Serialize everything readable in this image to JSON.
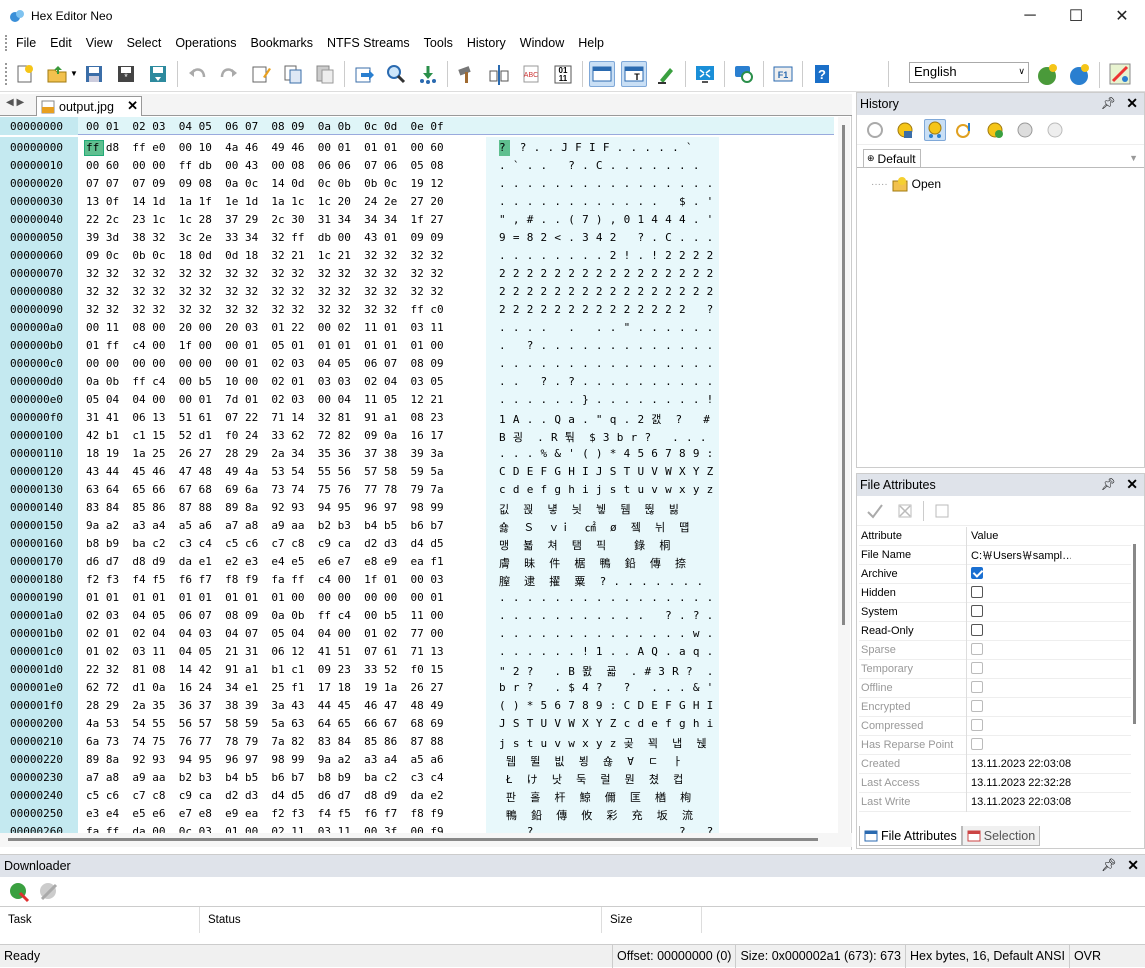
{
  "app": {
    "title": "Hex Editor Neo"
  },
  "window_controls": {
    "minimize": "─",
    "maximize": "☐",
    "close": "✕"
  },
  "menu": [
    "File",
    "Edit",
    "View",
    "Select",
    "Operations",
    "Bookmarks",
    "NTFS Streams",
    "Tools",
    "History",
    "Window",
    "Help"
  ],
  "language": {
    "selected": "English"
  },
  "editor": {
    "tab_label": "output.jpg",
    "header_offset": "00000000",
    "header_cols": "00 01  02 03  04 05  06 07  08 09  0a 0b  0c 0d  0e 0f",
    "rows": [
      {
        "off": "00000000",
        "hex": "ff d8  ff e0  00 10  4a 46  49 46  00 01  01 01  00 60",
        "asc": "?  ? . . J F I F . . . . . `"
      },
      {
        "off": "00000010",
        "hex": "00 60  00 00  ff db  00 43  00 08  06 06  07 06  05 08",
        "asc": ". ` . .   ? . C . . . . . . ."
      },
      {
        "off": "00000020",
        "hex": "07 07  07 09  09 08  0a 0c  14 0d  0c 0b  0b 0c  19 12",
        "asc": ". . . . . . . . . . . . . . . ."
      },
      {
        "off": "00000030",
        "hex": "13 0f  14 1d  1a 1f  1e 1d  1a 1c  1c 20  24 2e  27 20",
        "asc": ". . . . . . . . . . . .   $ . '"
      },
      {
        "off": "00000040",
        "hex": "22 2c  23 1c  1c 28  37 29  2c 30  31 34  34 34  1f 27",
        "asc": "\" , # . . ( 7 ) , 0 1 4 4 4 . '"
      },
      {
        "off": "00000050",
        "hex": "39 3d  38 32  3c 2e  33 34  32 ff  db 00  43 01  09 09",
        "asc": "9 = 8 2 < . 3 4 2   ? . C . . ."
      },
      {
        "off": "00000060",
        "hex": "09 0c  0b 0c  18 0d  0d 18  32 21  1c 21  32 32  32 32",
        "asc": ". . . . . . . . 2 ! . ! 2 2 2 2"
      },
      {
        "off": "00000070",
        "hex": "32 32  32 32  32 32  32 32  32 32  32 32  32 32  32 32",
        "asc": "2 2 2 2 2 2 2 2 2 2 2 2 2 2 2 2"
      },
      {
        "off": "00000080",
        "hex": "32 32  32 32  32 32  32 32  32 32  32 32  32 32  32 32",
        "asc": "2 2 2 2 2 2 2 2 2 2 2 2 2 2 2 2"
      },
      {
        "off": "00000090",
        "hex": "32 32  32 32  32 32  32 32  32 32  32 32  32 32  ff c0",
        "asc": "2 2 2 2 2 2 2 2 2 2 2 2 2 2   ?"
      },
      {
        "off": "000000a0",
        "hex": "00 11  08 00  20 00  20 03  01 22  00 02  11 01  03 11",
        "asc": ". . . .   .   . . \" . . . . . ."
      },
      {
        "off": "000000b0",
        "hex": "01 ff  c4 00  1f 00  00 01  05 01  01 01  01 01  01 00",
        "asc": ".   ? . . . . . . . . . . . . ."
      },
      {
        "off": "000000c0",
        "hex": "00 00  00 00  00 00  00 01  02 03  04 05  06 07  08 09",
        "asc": ". . . . . . . . . . . . . . . ."
      },
      {
        "off": "000000d0",
        "hex": "0a 0b  ff c4  00 b5  10 00  02 01  03 03  02 04  03 05",
        "asc": ". .   ? . ? . . . . . . . . . ."
      },
      {
        "off": "000000e0",
        "hex": "05 04  04 00  00 01  7d 01  02 03  00 04  11 05  12 21",
        "asc": ". . . . . . } . . . . . . . . !"
      },
      {
        "off": "000000f0",
        "hex": "31 41  06 13  51 61  07 22  71 14  32 81  91 a1  08 23",
        "asc": "1 A . . Q a . \" q . 2 갨  ?   #"
      },
      {
        "off": "00000100",
        "hex": "42 b1  c1 15  52 d1  f0 24  33 62  72 82  09 0a  16 17",
        "asc": "B 굉  . R 퉊  $ 3 b r ?   . . ."
      },
      {
        "off": "00000110",
        "hex": "18 19  1a 25  26 27  28 29  2a 34  35 36  37 38  39 3a",
        "asc": ". . . % & ' ( ) * 4 5 6 7 8 9 :"
      },
      {
        "off": "00000120",
        "hex": "43 44  45 46  47 48  49 4a  53 54  55 56  57 58  59 5a",
        "asc": "C D E F G H I J S T U V W X Y Z"
      },
      {
        "off": "00000130",
        "hex": "63 64  65 66  67 68  69 6a  73 74  75 76  77 78  79 7a",
        "asc": "c d e f g h i j s t u v w x y z"
      },
      {
        "off": "00000140",
        "hex": "83 84  85 86  87 88  89 8a  92 93  94 95  96 97  98 99",
        "asc": "깂  꾅  넇  늿  뉗  뒘  뛶  빓"
      },
      {
        "off": "00000150",
        "hex": "9a a2  a3 a4  a5 a6  a7 a8  a9 aa  b2 b3  b4 b5  b6 b7",
        "asc": "숋  Ｓ  ｖｉ  ㎠  ø  젴  뉘  떕"
      },
      {
        "off": "00000160",
        "hex": "b8 b9  ba c2  c3 c4  c5 c6  c7 c8  c9 ca  d2 d3  d4 d5",
        "asc": "맹  뵯  쳐  탬  픽    錄  桐"
      },
      {
        "off": "00000170",
        "hex": "d6 d7  d8 d9  da e1  e2 e3  e4 e5  e6 e7  e8 e9  ea f1",
        "asc": "膚  昧  件  椐  鴨  鉛  傳  捺"
      },
      {
        "off": "00000180",
        "hex": "f2 f3  f4 f5  f6 f7  f8 f9  fa ff  c4 00  1f 01  00 03",
        "asc": "膣  逮  擢  粟  ? . . . . . . ."
      },
      {
        "off": "00000190",
        "hex": "01 01  01 01  01 01  01 01  01 00  00 00  00 00  00 01",
        "asc": ". . . . . . . . . . . . . . . ."
      },
      {
        "off": "000001a0",
        "hex": "02 03  04 05  06 07  08 09  0a 0b  ff c4  00 b5  11 00",
        "asc": ". . . . . . . . . . .   ? . ? ."
      },
      {
        "off": "000001b0",
        "hex": "02 01  02 04  04 03  04 07  05 04  04 00  01 02  77 00",
        "asc": ". . . . . . . . . . . . . . w ."
      },
      {
        "off": "000001c0",
        "hex": "01 02  03 11  04 05  21 31  06 12  41 51  07 61  71 13",
        "asc": ". . . . . . ! 1 . . A Q . a q ."
      },
      {
        "off": "000001d0",
        "hex": "22 32  81 08  14 42  91 a1  b1 c1  09 23  33 52  f0 15",
        "asc": "\" 2 ?   . B 뫐  굛  . # 3 R ?  ."
      },
      {
        "off": "000001e0",
        "hex": "62 72  d1 0a  16 24  34 e1  25 f1  17 18  19 1a  26 27",
        "asc": "b r ?   . $ 4 ?   ?   . . . & '"
      },
      {
        "off": "000001f0",
        "hex": "28 29  2a 35  36 37  38 39  3a 43  44 45  46 47  48 49",
        "asc": "( ) * 5 6 7 8 9 : C D E F G H I"
      },
      {
        "off": "00000200",
        "hex": "4a 53  54 55  56 57  58 59  5a 63  64 65  66 67  68 69",
        "asc": "J S T U V W X Y Z c d e f g h i"
      },
      {
        "off": "00000210",
        "hex": "6a 73  74 75  76 77  78 79  7a 82  83 84  85 86  87 88",
        "asc": "j s t u v w x y z 곶  꾁  냅  뉁"
      },
      {
        "off": "00000220",
        "hex": "89 8a  92 93  94 95  96 97  98 99  9a a2  a3 a4  a5 a6",
        "asc": " 뒙  뛸  빖  뵝  숂  ∀  ㄷ  ㅏ"
      },
      {
        "off": "00000230",
        "hex": "a7 a8  a9 aa  b2 b3  b4 b5  b6 b7  b8 b9  ba c2  c3 c4",
        "asc": " Ł  け  낫  둑  럴  뭔  쳤  컵"
      },
      {
        "off": "00000240",
        "hex": "c5 c6  c7 c8  c9 ca  d2 d3  d4 d5  d6 d7  d8 d9  da e2",
        "asc": " 판  홀  杆  鯨  儞  匡  楢  栒"
      },
      {
        "off": "00000250",
        "hex": "e3 e4  e5 e6  e7 e8  e9 ea  f2 f3  f4 f5  f6 f7  f8 f9",
        "asc": " 鴨  鉛  傳  攸  彩  充  坂  流"
      },
      {
        "off": "00000260",
        "hex": "fa ff  da 00  0c 03  01 00  02 11  03 11  00 3f  00 f9",
        "asc": "    ? . . . . . . . . . . ? . ?"
      }
    ]
  },
  "history": {
    "title": "History",
    "tab": "Default",
    "items": [
      "Open"
    ]
  },
  "file_attributes": {
    "title": "File Attributes",
    "col_attribute": "Attribute",
    "col_value": "Value",
    "rows": [
      {
        "name": "File Name",
        "value": "C:￦Users￦sampl…",
        "type": "text",
        "enabled": true
      },
      {
        "name": "Archive",
        "checked": true,
        "type": "check",
        "enabled": true
      },
      {
        "name": "Hidden",
        "checked": false,
        "type": "check",
        "enabled": true
      },
      {
        "name": "System",
        "checked": false,
        "type": "check",
        "enabled": true
      },
      {
        "name": "Read-Only",
        "checked": false,
        "type": "check",
        "enabled": true
      },
      {
        "name": "Sparse",
        "checked": false,
        "type": "check",
        "enabled": false
      },
      {
        "name": "Temporary",
        "checked": false,
        "type": "check",
        "enabled": false
      },
      {
        "name": "Offline",
        "checked": false,
        "type": "check",
        "enabled": false
      },
      {
        "name": "Encrypted",
        "checked": false,
        "type": "check",
        "enabled": false
      },
      {
        "name": "Compressed",
        "checked": false,
        "type": "check",
        "enabled": false
      },
      {
        "name": "Has Reparse Point",
        "checked": false,
        "type": "check",
        "enabled": false
      },
      {
        "name": "Created",
        "value": "13.11.2023 22:03:08",
        "type": "text",
        "enabled": false
      },
      {
        "name": "Last Access",
        "value": "13.11.2023 22:32:28",
        "type": "text",
        "enabled": false
      },
      {
        "name": "Last Write",
        "value": "13.11.2023 22:03:08",
        "type": "text",
        "enabled": false
      }
    ],
    "tabs": [
      "File Attributes",
      "Selection"
    ]
  },
  "downloader": {
    "title": "Downloader",
    "columns": [
      "Task",
      "Status",
      "Size"
    ]
  },
  "status": {
    "ready": "Ready",
    "offset": "Offset: 00000000 (0)",
    "size": "Size: 0x000002a1 (673): 673",
    "mode": "Hex bytes, 16, Default ANSI",
    "ovr": "OVR"
  }
}
